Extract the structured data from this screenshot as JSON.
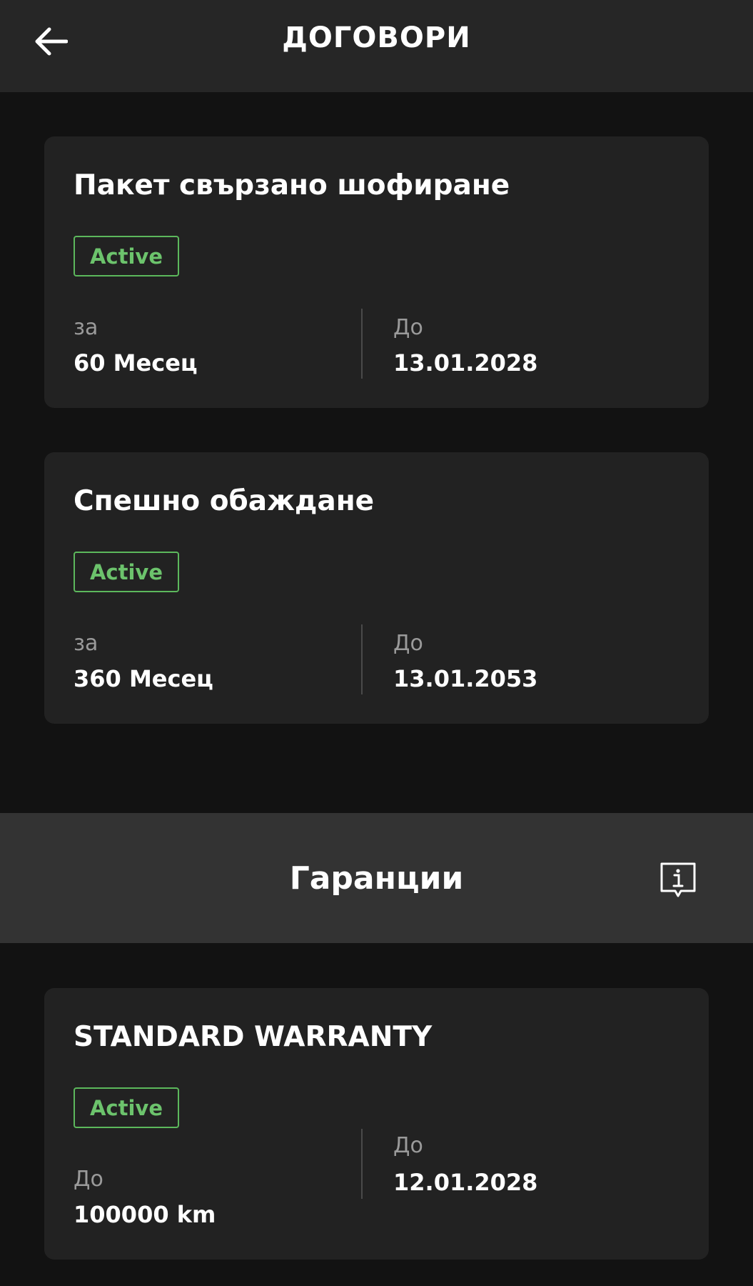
{
  "header": {
    "title": "ДОГОВОРИ",
    "back_icon": "arrow-left-icon"
  },
  "contracts": [
    {
      "title": "Пакет свързано шофиране",
      "status": "Active",
      "duration_label": "за",
      "duration_value": "60 Месец",
      "until_label": "До",
      "until_value": "13.01.2028"
    },
    {
      "title": "Спешно обаждане",
      "status": "Active",
      "duration_label": "за",
      "duration_value": "360 Месец",
      "until_label": "До",
      "until_value": "13.01.2053"
    }
  ],
  "warranties": {
    "section_title": "Гаранции",
    "info_icon": "info-message-icon",
    "items": [
      {
        "title": "STANDARD WARRANTY",
        "status": "Active",
        "mileage_label": "До",
        "mileage_value": "100000 km",
        "until_label": "До",
        "until_value": "12.01.2028"
      }
    ]
  },
  "colors": {
    "background": "#121212",
    "header": "#262626",
    "card": "#222222",
    "section_bar": "#333333",
    "active_green": "#5cb85c"
  }
}
